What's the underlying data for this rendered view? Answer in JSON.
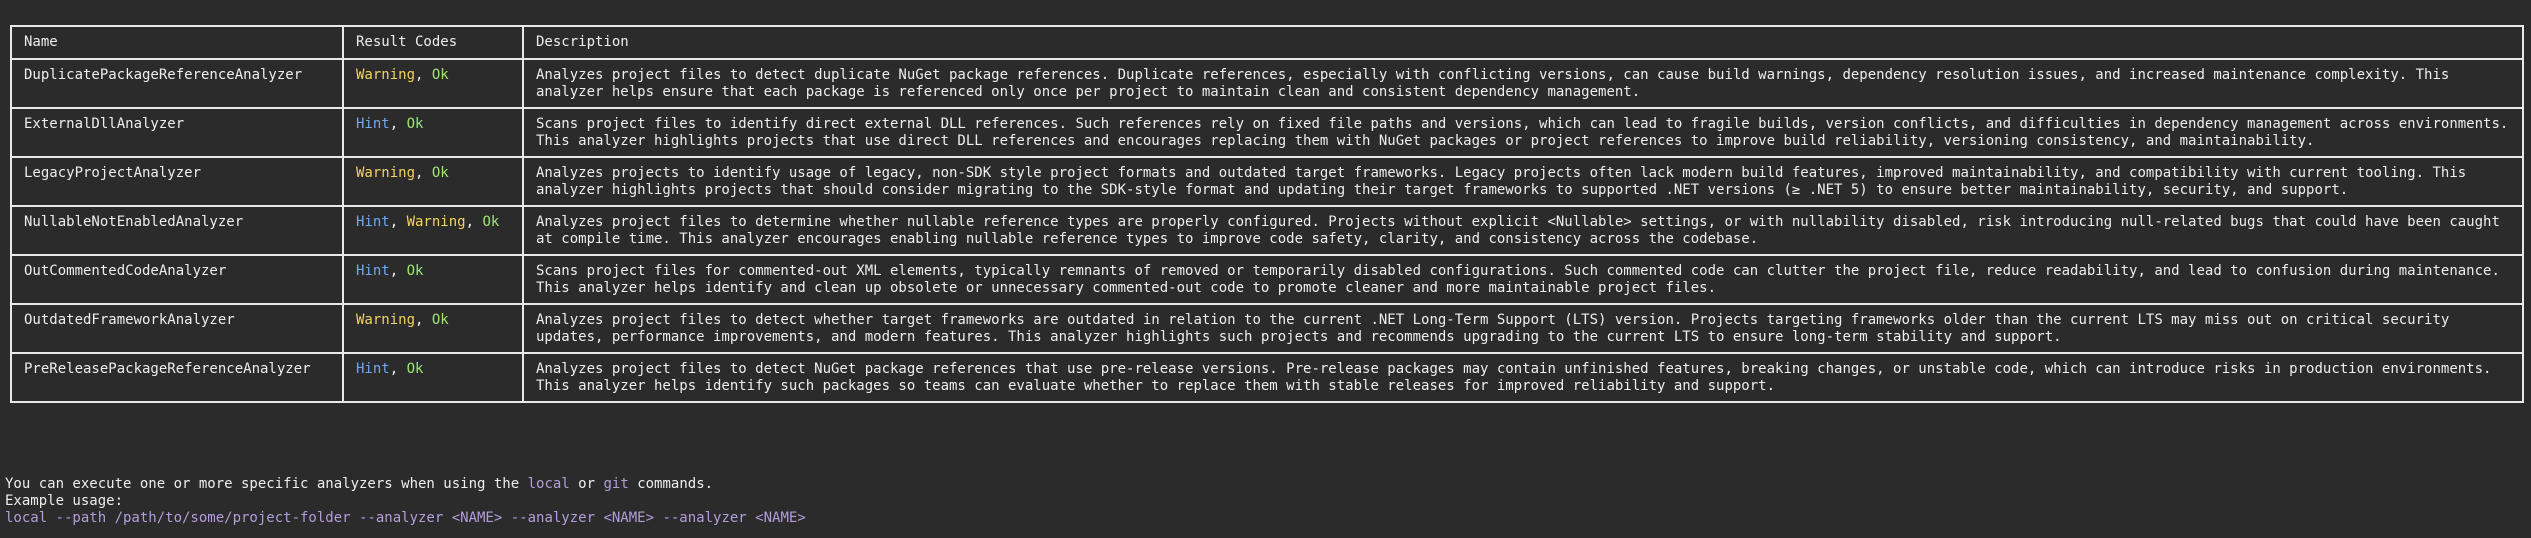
{
  "table": {
    "headers": {
      "name": "Name",
      "codes": "Result Codes",
      "description": "Description"
    },
    "rows": [
      {
        "name": "DuplicatePackageReferenceAnalyzer",
        "codes": [
          {
            "text": "Warning",
            "kind": "warning"
          },
          {
            "text": "Ok",
            "kind": "ok"
          }
        ],
        "description": "Analyzes project files to detect duplicate NuGet package references. Duplicate references, especially with conflicting versions, can cause build warnings, dependency resolution issues, and increased maintenance complexity. This analyzer helps ensure that each package is referenced only once per project to maintain clean and consistent dependency management."
      },
      {
        "name": "ExternalDllAnalyzer",
        "codes": [
          {
            "text": "Hint",
            "kind": "hint"
          },
          {
            "text": "Ok",
            "kind": "ok"
          }
        ],
        "description": "Scans project files to identify direct external DLL references. Such references rely on fixed file paths and versions, which can lead to fragile builds, version conflicts, and difficulties in dependency management across environments. This analyzer highlights projects that use direct DLL references and encourages replacing them with NuGet packages or project references to improve build reliability, versioning consistency, and maintainability."
      },
      {
        "name": "LegacyProjectAnalyzer",
        "codes": [
          {
            "text": "Warning",
            "kind": "warning"
          },
          {
            "text": "Ok",
            "kind": "ok"
          }
        ],
        "description": "Analyzes projects to identify usage of legacy, non-SDK style project formats and outdated target frameworks. Legacy projects often lack modern build features, improved maintainability, and compatibility with current tooling. This analyzer highlights projects that should consider migrating to the SDK-style format and updating their target frameworks to supported .NET versions (≥ .NET 5) to ensure better maintainability, security, and support."
      },
      {
        "name": "NullableNotEnabledAnalyzer",
        "codes": [
          {
            "text": "Hint",
            "kind": "hint"
          },
          {
            "text": "Warning",
            "kind": "warning"
          },
          {
            "text": "Ok",
            "kind": "ok"
          }
        ],
        "description": "Analyzes project files to determine whether nullable reference types are properly configured. Projects without explicit <Nullable> settings, or with nullability disabled, risk introducing null-related bugs that could have been caught at compile time. This analyzer encourages enabling nullable reference types to improve code safety, clarity, and consistency across the codebase."
      },
      {
        "name": "OutCommentedCodeAnalyzer",
        "codes": [
          {
            "text": "Hint",
            "kind": "hint"
          },
          {
            "text": "Ok",
            "kind": "ok"
          }
        ],
        "description": "Scans project files for commented-out XML elements, typically remnants of removed or temporarily disabled configurations. Such commented code can clutter the project file, reduce readability, and lead to confusion during maintenance. This analyzer helps identify and clean up obsolete or unnecessary commented-out code to promote cleaner and more maintainable project files."
      },
      {
        "name": "OutdatedFrameworkAnalyzer",
        "codes": [
          {
            "text": "Warning",
            "kind": "warning"
          },
          {
            "text": "Ok",
            "kind": "ok"
          }
        ],
        "description": "Analyzes project files to detect whether target frameworks are outdated in relation to the current .NET Long-Term Support (LTS) version. Projects targeting frameworks older than the current LTS may miss out on critical security updates, performance improvements, and modern features. This analyzer highlights such projects and recommends upgrading to the current LTS to ensure long-term stability and support."
      },
      {
        "name": "PreReleasePackageReferenceAnalyzer",
        "codes": [
          {
            "text": "Hint",
            "kind": "hint"
          },
          {
            "text": "Ok",
            "kind": "ok"
          }
        ],
        "description": "Analyzes project files to detect NuGet package references that use pre-release versions. Pre-release packages may contain unfinished features, breaking changes, or unstable code, which can introduce risks in production environments. This analyzer helps identify such packages so teams can evaluate whether to replace them with stable releases for improved reliability and support."
      }
    ]
  },
  "footer": {
    "line1_prefix": "You can execute one or more specific analyzers when using the ",
    "line1_cmd1": "local",
    "line1_mid": " or ",
    "line1_cmd2": "git",
    "line1_suffix": " commands.",
    "line2": "Example usage:",
    "line3": "local --path /path/to/some/project-folder --analyzer <NAME> --analyzer <NAME> --analyzer <NAME>"
  },
  "colors": {
    "background": "#2b2b2b",
    "text": "#eeeeee",
    "warning": "#f4d35e",
    "ok": "#9fe870",
    "hint": "#6fa8f0",
    "command": "#b39ddb"
  }
}
